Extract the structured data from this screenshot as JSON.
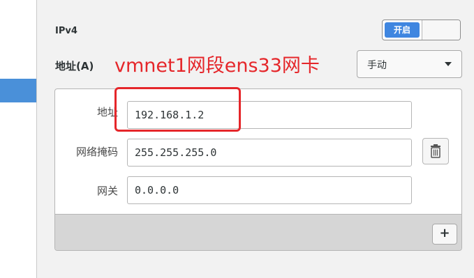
{
  "ipv4": {
    "section_label": "IPv4",
    "toggle_label": "开启",
    "toggle_state": "on",
    "accent_color": "#3f86e0"
  },
  "addresses": {
    "method_label": "地址(A)",
    "method_value": "手动"
  },
  "annotation": {
    "text": "vmnet1网段ens33网卡",
    "color": "#e5262a"
  },
  "fields": {
    "address": {
      "label": "地址",
      "value": "192.168.1.2"
    },
    "netmask": {
      "label": "网络掩码",
      "value": "255.255.255.0"
    },
    "gateway": {
      "label": "网关",
      "value": "0.0.0.0"
    }
  },
  "buttons": {
    "add_label": "+",
    "delete_icon": "trash-icon"
  },
  "sidebar": {
    "selected_color": "#4a90d9"
  }
}
